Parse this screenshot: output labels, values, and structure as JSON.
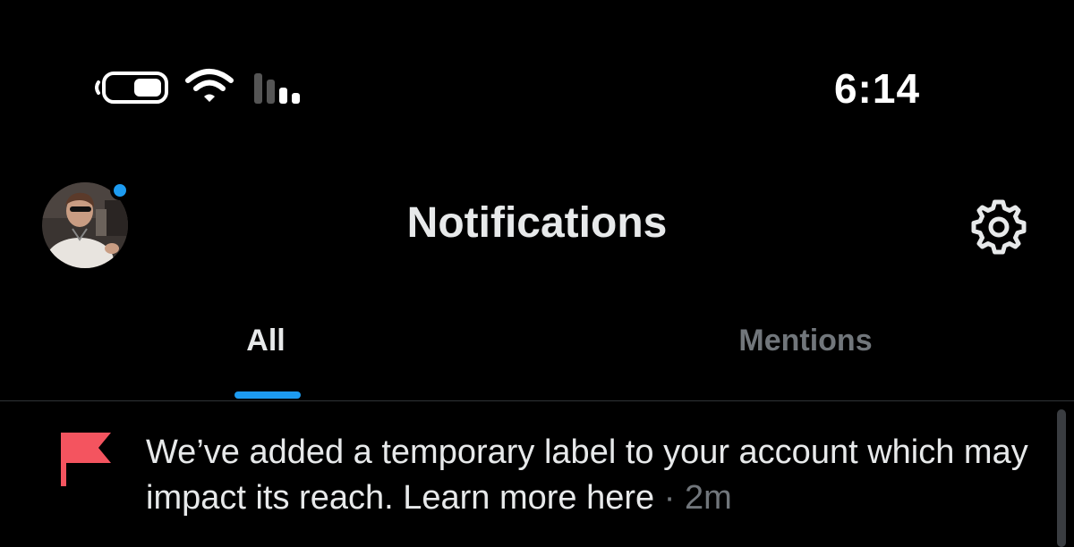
{
  "status_bar": {
    "time": "6:14",
    "battery_icon": "battery-icon",
    "wifi_icon": "wifi-icon",
    "signal_icon": "cellular-signal-icon"
  },
  "header": {
    "title": "Notifications",
    "avatar_icon": "profile-avatar",
    "settings_icon": "gear-icon",
    "has_unread_dot": true
  },
  "tabs": [
    {
      "label": "All",
      "active": true
    },
    {
      "label": "Mentions",
      "active": false
    }
  ],
  "notifications": [
    {
      "icon": "flag-icon",
      "text": "We’ve added a temporary label to your account which may impact its reach. Learn more here",
      "separator": " · ",
      "time": "2m"
    }
  ],
  "colors": {
    "background": "#000000",
    "accent": "#1d9bf0",
    "flag": "#f4545f",
    "primary_text": "#e7e9ea",
    "secondary_text": "#71767b"
  }
}
